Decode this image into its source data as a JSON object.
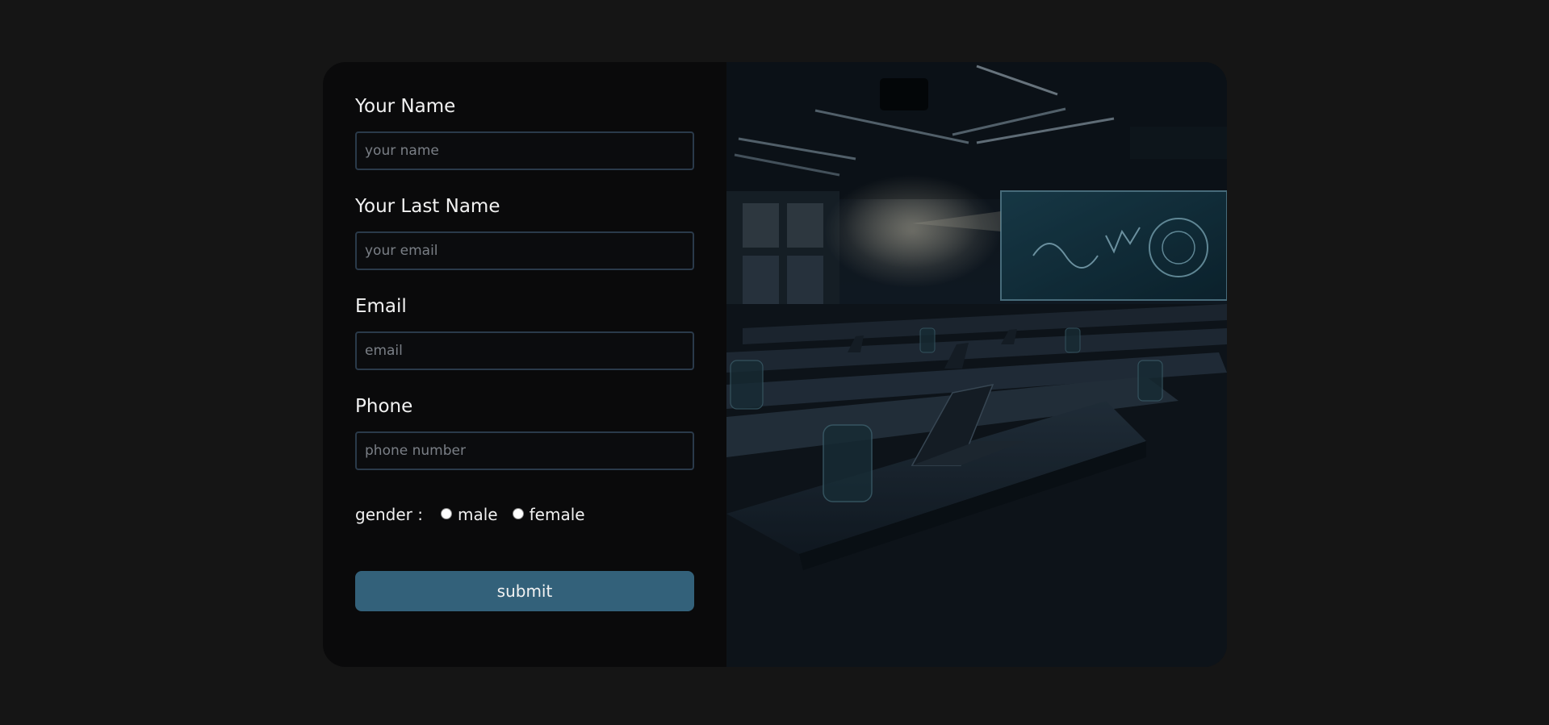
{
  "form": {
    "first_name": {
      "label": "Your Name",
      "placeholder": "your name"
    },
    "last_name": {
      "label": "Your Last Name",
      "placeholder": "your email"
    },
    "email": {
      "label": "Email",
      "placeholder": "email"
    },
    "phone": {
      "label": "Phone",
      "placeholder": "phone number"
    },
    "gender": {
      "label": "gender :",
      "options": [
        "male",
        "female"
      ]
    },
    "submit_label": "submit"
  },
  "image": {
    "subject": "classroom-photo"
  },
  "colors": {
    "page_background": "#151515",
    "card_background": "#0a0a0b",
    "input_border": "#2a3a4a",
    "button_background": "#33617a",
    "text": "#f2f2f2"
  }
}
